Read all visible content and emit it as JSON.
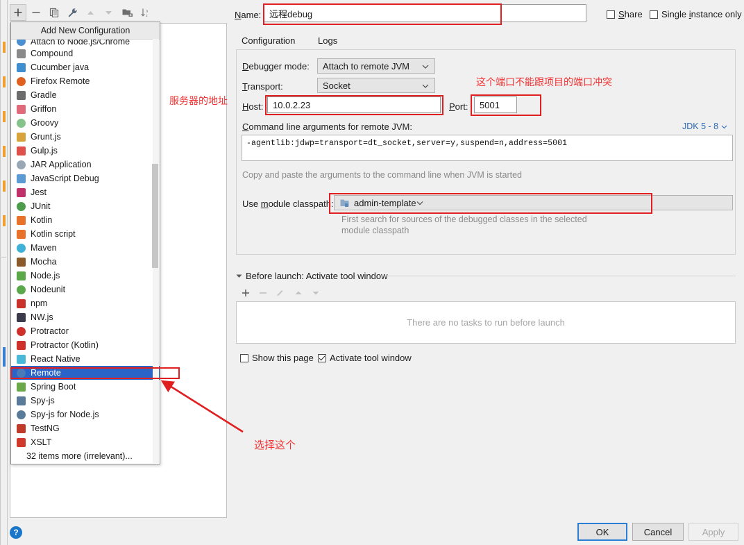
{
  "toolbar": {
    "buttons": [
      {
        "name": "add",
        "glyph": "+",
        "active": true
      },
      {
        "name": "remove",
        "glyph": "−",
        "active": false
      },
      {
        "name": "copy",
        "glyph": "copy-icon",
        "active": false
      },
      {
        "name": "edit-templates",
        "glyph": "wrench-icon",
        "active": false
      },
      {
        "name": "move-up",
        "glyph": "triangle-up-icon",
        "active": false
      },
      {
        "name": "move-down",
        "glyph": "triangle-down-icon",
        "active": false
      },
      {
        "name": "new-folder",
        "glyph": "folder-add-icon",
        "active": false
      },
      {
        "name": "sort-alphabetically",
        "glyph": "sort-az-icon",
        "active": false
      }
    ]
  },
  "popup": {
    "header": "Add New Configuration",
    "items": [
      {
        "label": "Attach to Node.js/Chrome",
        "icon": "nodejs-attach-icon",
        "color": "#4a8fd0",
        "clipped": true
      },
      {
        "label": "Compound",
        "icon": "compound-icon",
        "color": "#8a8a8a"
      },
      {
        "label": "Cucumber java",
        "icon": "cucumber-icon",
        "color": "#3f8fd0"
      },
      {
        "label": "Firefox Remote",
        "icon": "firefox-icon",
        "color": "#e06020"
      },
      {
        "label": "Gradle",
        "icon": "gradle-icon",
        "color": "#6d6d6d"
      },
      {
        "label": "Griffon",
        "icon": "griffon-icon",
        "color": "#e06a7a"
      },
      {
        "label": "Groovy",
        "icon": "groovy-icon",
        "color": "#86c28b"
      },
      {
        "label": "Grunt.js",
        "icon": "grunt-icon",
        "color": "#d7a33a"
      },
      {
        "label": "Gulp.js",
        "icon": "gulp-icon",
        "color": "#e0504a"
      },
      {
        "label": "JAR Application",
        "icon": "jar-icon",
        "color": "#9aa7b5"
      },
      {
        "label": "JavaScript Debug",
        "icon": "javascript-debug-icon",
        "color": "#5a9bd4"
      },
      {
        "label": "Jest",
        "icon": "jest-icon",
        "color": "#c0306a"
      },
      {
        "label": "JUnit",
        "icon": "junit-icon",
        "color": "#4c9c4c"
      },
      {
        "label": "Kotlin",
        "icon": "kotlin-icon",
        "color": "#e8722a"
      },
      {
        "label": "Kotlin script",
        "icon": "kotlin-script-icon",
        "color": "#e8722a"
      },
      {
        "label": "Maven",
        "icon": "maven-icon",
        "color": "#3fb0d8"
      },
      {
        "label": "Mocha",
        "icon": "mocha-icon",
        "color": "#8a5a2a"
      },
      {
        "label": "Node.js",
        "icon": "nodejs-icon",
        "color": "#5aa84a"
      },
      {
        "label": "Nodeunit",
        "icon": "nodeunit-icon",
        "color": "#5aa84a"
      },
      {
        "label": "npm",
        "icon": "npm-icon",
        "color": "#c8322a"
      },
      {
        "label": "NW.js",
        "icon": "nwjs-icon",
        "color": "#3a3a4a"
      },
      {
        "label": "Protractor",
        "icon": "protractor-icon",
        "color": "#d0302a"
      },
      {
        "label": "Protractor (Kotlin)",
        "icon": "protractor-kotlin-icon",
        "color": "#d0302a"
      },
      {
        "label": "React Native",
        "icon": "react-native-icon",
        "color": "#4ab8d8"
      },
      {
        "label": "Remote",
        "icon": "remote-icon",
        "color": "#4a7ab8",
        "selected": true
      },
      {
        "label": "Spring Boot",
        "icon": "spring-boot-icon",
        "color": "#6aa84a"
      },
      {
        "label": "Spy-js",
        "icon": "spyjs-icon",
        "color": "#5a7a9a"
      },
      {
        "label": "Spy-js for Node.js",
        "icon": "spyjs-node-icon",
        "color": "#5a7a9a"
      },
      {
        "label": "TestNG",
        "icon": "testng-icon",
        "color": "#c03a2a"
      },
      {
        "label": "XSLT",
        "icon": "xslt-icon",
        "color": "#d03a2a"
      },
      {
        "label": "32 items more (irrelevant)...",
        "icon": "",
        "color": "",
        "plain": true
      }
    ]
  },
  "header": {
    "name_label": "Name:",
    "name_value": "远程debug",
    "share_label": "Share",
    "share_checked": false,
    "single_instance_label": "Single instance only",
    "single_instance_checked": false
  },
  "tabs": [
    {
      "label": "Configuration",
      "selected": true
    },
    {
      "label": "Logs",
      "selected": false
    }
  ],
  "form": {
    "debugger_mode_label": "Debugger mode:",
    "debugger_mode_value": "Attach to remote JVM",
    "transport_label": "Transport:",
    "transport_value": "Socket",
    "host_label": "Host:",
    "host_value": "10.0.2.23",
    "port_label": "Port:",
    "port_value": "5001",
    "cmdline_label": "Command line arguments for remote JVM:",
    "jdk_selector": "JDK 5 - 8",
    "cmdline_value": "-agentlib:jdwp=transport=dt_socket,server=y,suspend=n,address=5001",
    "copy_hint": "Copy and paste the arguments to the command line when JVM is started",
    "module_classpath_label": "Use module classpath:",
    "module_classpath_value": "admin-template",
    "module_hint_line1": "First search for sources of the debugged classes in the selected",
    "module_hint_line2": "module classpath"
  },
  "before_launch": {
    "title": "Before launch: Activate tool window",
    "buttons": [
      {
        "name": "add-task",
        "glyph": "+",
        "enabled": true
      },
      {
        "name": "remove-task",
        "glyph": "−",
        "enabled": false
      },
      {
        "name": "edit-task",
        "glyph": "pencil-icon",
        "enabled": false
      },
      {
        "name": "move-task-up",
        "glyph": "triangle-up-icon",
        "enabled": false
      },
      {
        "name": "move-task-down",
        "glyph": "triangle-down-icon",
        "enabled": false
      }
    ],
    "empty_text": "There are no tasks to run before launch",
    "show_page_label": "Show this page",
    "show_page_checked": false,
    "activate_tool_window_label": "Activate tool window",
    "activate_tool_window_checked": true
  },
  "footer": {
    "ok": "OK",
    "cancel": "Cancel",
    "apply": "Apply",
    "help": "?"
  },
  "annotations": {
    "host_note": "服务器的地址",
    "port_note": "这个端口不能跟项目的端口冲突",
    "select_note": "选择这个",
    "color": "#f03232"
  }
}
